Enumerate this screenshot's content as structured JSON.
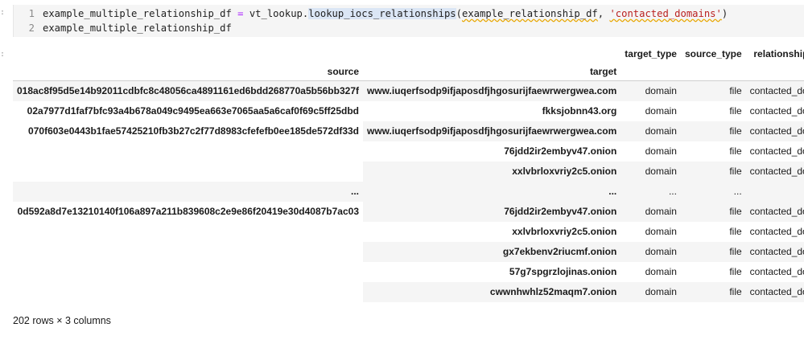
{
  "input_cell": {
    "prompt": "[ ]:",
    "lines": [
      {
        "number": "1",
        "var": "example_multiple_relationship_df",
        "eq": " = ",
        "obj": "vt_lookup.",
        "fn": "lookup_iocs_relationships",
        "open": "(",
        "arg": "example_relationship_df",
        "comma": ", ",
        "str": "'contacted_domains'",
        "close": ")"
      },
      {
        "number": "2",
        "text": "example_multiple_relationship_df"
      }
    ]
  },
  "output_cell": {
    "prompt": "[ ]:"
  },
  "dataframe": {
    "columns": [
      "target_type",
      "source_type",
      "relationship_type"
    ],
    "index_names": [
      "source",
      "target"
    ],
    "groups": [
      {
        "source": "018ac8f95d5e14b92011cdbfc8c48056ca4891161ed6bdd268770a5b56bb327f",
        "rows": [
          {
            "target": "www.iuqerfsodp9ifjaposdfjhgosurijfaewrwergwea.com",
            "target_type": "domain",
            "source_type": "file",
            "relationship_type": "contacted_domains"
          }
        ]
      },
      {
        "source": "02a7977d1faf7bfc93a4b678a049c9495ea663e7065aa5a6caf0f69c5ff25dbd",
        "rows": [
          {
            "target": "fkksjobnn43.org",
            "target_type": "domain",
            "source_type": "file",
            "relationship_type": "contacted_domains"
          }
        ]
      },
      {
        "source": "070f603e0443b1fae57425210fb3b27c2f77d8983cfefefb0ee185de572df33d",
        "rows": [
          {
            "target": "www.iuqerfsodp9ifjaposdfjhgosurijfaewrwergwea.com",
            "target_type": "domain",
            "source_type": "file",
            "relationship_type": "contacted_domains"
          },
          {
            "target": "76jdd2ir2embyv47.onion",
            "target_type": "domain",
            "source_type": "file",
            "relationship_type": "contacted_domains"
          },
          {
            "target": "xxlvbrloxvriy2c5.onion",
            "target_type": "domain",
            "source_type": "file",
            "relationship_type": "contacted_domains"
          }
        ]
      },
      {
        "source": "...",
        "ellipsis": true,
        "rows": [
          {
            "target": "...",
            "target_type": "...",
            "source_type": "...",
            "relationship_type": "..."
          }
        ]
      },
      {
        "source": "0d592a8d7e13210140f106a897a211b839608c2e9e86f20419e30d4087b7ac03",
        "rows": [
          {
            "target": "76jdd2ir2embyv47.onion",
            "target_type": "domain",
            "source_type": "file",
            "relationship_type": "contacted_domains"
          },
          {
            "target": "xxlvbrloxvriy2c5.onion",
            "target_type": "domain",
            "source_type": "file",
            "relationship_type": "contacted_domains"
          },
          {
            "target": "gx7ekbenv2riucmf.onion",
            "target_type": "domain",
            "source_type": "file",
            "relationship_type": "contacted_domains"
          },
          {
            "target": "57g7spgrzlojinas.onion",
            "target_type": "domain",
            "source_type": "file",
            "relationship_type": "contacted_domains"
          },
          {
            "target": "cwwnhwhlz52maqm7.onion",
            "target_type": "domain",
            "source_type": "file",
            "relationship_type": "contacted_domains"
          }
        ]
      }
    ],
    "shape_text": "202 rows × 3 columns"
  }
}
